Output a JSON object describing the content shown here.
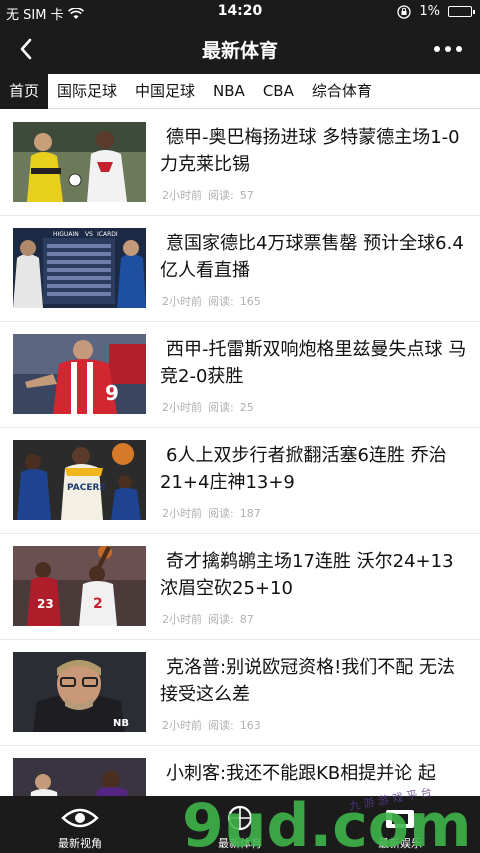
{
  "status_bar": {
    "carrier": "无 SIM 卡",
    "time": "14:20",
    "battery": "1%"
  },
  "nav": {
    "title": "最新体育"
  },
  "tabs": [
    "首页",
    "国际足球",
    "中国足球",
    "NBA",
    "CBA",
    "综合体育"
  ],
  "news": [
    {
      "title": "德甲-奥巴梅扬进球 多特蒙德主场1-0力克莱比锡",
      "time": "2小时前",
      "reads_label": "阅读:",
      "reads": "57"
    },
    {
      "title": "意国家德比4万球票售罄 预计全球6.4亿人看直播",
      "time": "2小时前",
      "reads_label": "阅读:",
      "reads": "165"
    },
    {
      "title": "西甲-托雷斯双响炮格里兹曼失点球 马竞2-0获胜",
      "time": "2小时前",
      "reads_label": "阅读:",
      "reads": "25"
    },
    {
      "title": "6人上双步行者掀翻活塞6连胜 乔治21+4庄神13+9",
      "time": "2小时前",
      "reads_label": "阅读:",
      "reads": "187"
    },
    {
      "title": "奇才擒鹈鹕主场17连胜 沃尔24+13浓眉空砍25+10",
      "time": "2小时前",
      "reads_label": "阅读:",
      "reads": "87"
    },
    {
      "title": "克洛普:别说欧冠资格!我们不配 无法接受这么差",
      "time": "2小时前",
      "reads_label": "阅读:",
      "reads": "163"
    },
    {
      "title": "小刺客:我还不能跟KB相提并论 起",
      "time": "",
      "reads_label": "",
      "reads": ""
    }
  ],
  "thumb_text": {
    "higuain": "HIGUAIN",
    "vs": "VS",
    "icardi": "ICARDI",
    "pacers": "PACERS",
    "jersey_9": "9",
    "jersey_23": "23",
    "jersey_2": "2",
    "jersey_nb": "NB"
  },
  "tab_bar": [
    {
      "label": "最新视角",
      "icon": "eye-icon"
    },
    {
      "label": "最新体育",
      "icon": "ball-icon"
    },
    {
      "label": "最新娱乐",
      "icon": "tv-icon"
    }
  ],
  "watermark": {
    "text": "9ud.com",
    "sub": "九 游 游 戏 平 台"
  },
  "colors": {
    "bar_bg": "#1b1b1b",
    "meta_text": "#b0b0b0",
    "watermark_green": "#3fb54a",
    "watermark_purple": "#5b3b8c"
  }
}
